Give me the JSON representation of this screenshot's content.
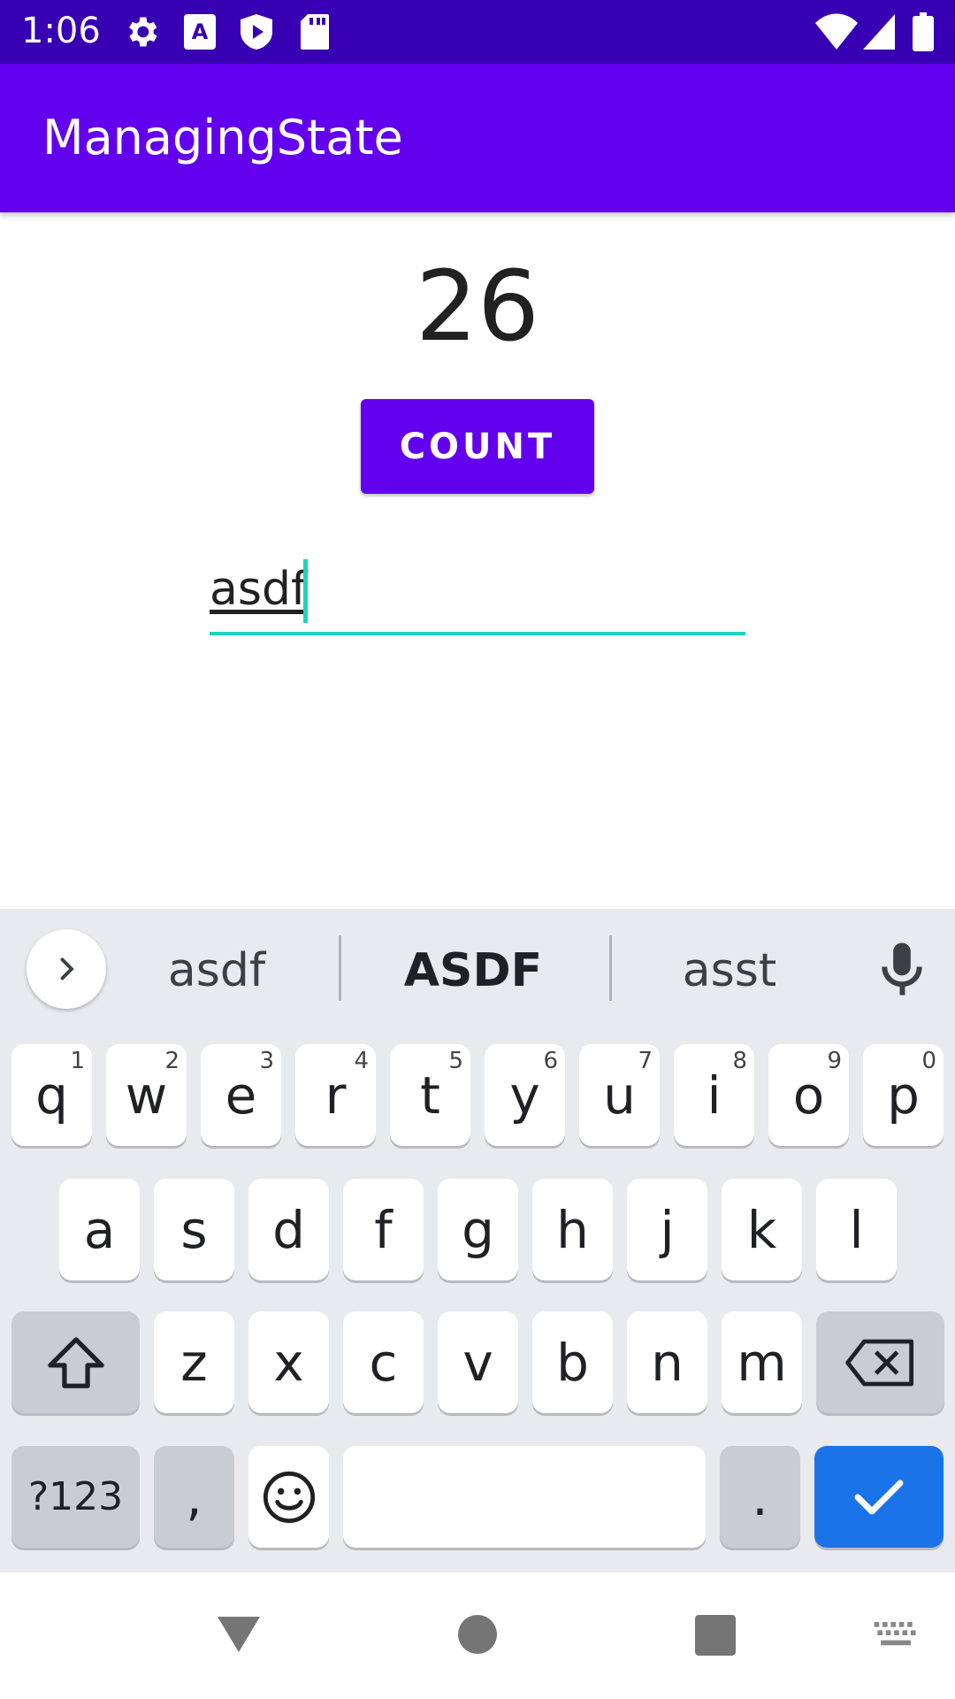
{
  "status_bar": {
    "time": "1:06",
    "icons": [
      "settings-icon",
      "font-a-icon",
      "play-shield-icon",
      "sd-card-icon",
      "wifi-icon",
      "signal-icon",
      "battery-icon"
    ]
  },
  "app_bar": {
    "title": "ManagingState"
  },
  "counter": {
    "value": "26"
  },
  "count_button": {
    "label": "COUNT"
  },
  "text_field": {
    "value": "asdf",
    "accent_color": "#1ed3c3"
  },
  "keyboard": {
    "suggestions": [
      "asdf",
      "ASDF",
      "asst"
    ],
    "row1": [
      {
        "key": "q",
        "hint": "1"
      },
      {
        "key": "w",
        "hint": "2"
      },
      {
        "key": "e",
        "hint": "3"
      },
      {
        "key": "r",
        "hint": "4"
      },
      {
        "key": "t",
        "hint": "5"
      },
      {
        "key": "y",
        "hint": "6"
      },
      {
        "key": "u",
        "hint": "7"
      },
      {
        "key": "i",
        "hint": "8"
      },
      {
        "key": "o",
        "hint": "9"
      },
      {
        "key": "p",
        "hint": "0"
      }
    ],
    "row2": [
      "a",
      "s",
      "d",
      "f",
      "g",
      "h",
      "j",
      "k",
      "l"
    ],
    "row3": [
      "z",
      "x",
      "c",
      "v",
      "b",
      "n",
      "m"
    ],
    "symbols_label": "?123",
    "comma_label": ",",
    "period_label": "."
  },
  "colors": {
    "status_bar": "#3700b3",
    "primary": "#6200ee",
    "enter_key": "#1a73e8"
  }
}
